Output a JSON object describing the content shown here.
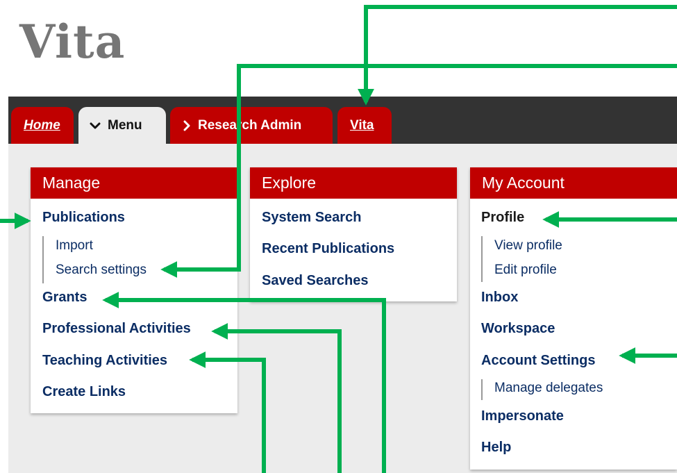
{
  "app": {
    "title": "Vita"
  },
  "nav": {
    "tabs": [
      {
        "label": "Home",
        "icon": ""
      },
      {
        "label": "Menu",
        "icon": "chevron-down-icon"
      },
      {
        "label": "Research Admin",
        "icon": "chevron-right-icon"
      },
      {
        "label": "Vita",
        "icon": ""
      }
    ]
  },
  "panels": {
    "manage": {
      "title": "Manage",
      "items": {
        "publications": "Publications",
        "import": "Import",
        "search_settings": "Search settings",
        "grants": "Grants",
        "professional_activities": "Professional Activities",
        "teaching_activities": "Teaching Activities",
        "create_links": "Create Links"
      }
    },
    "explore": {
      "title": "Explore",
      "items": {
        "system_search": "System Search",
        "recent_publications": "Recent Publications",
        "saved_searches": "Saved Searches"
      }
    },
    "account": {
      "title": "My Account",
      "items": {
        "profile": "Profile",
        "view_profile": "View profile",
        "edit_profile": "Edit profile",
        "inbox": "Inbox",
        "workspace": "Workspace",
        "account_settings": "Account Settings",
        "manage_delegates": "Manage delegates",
        "impersonate": "Impersonate",
        "help": "Help"
      }
    }
  },
  "colors": {
    "brand_red": "#c00000",
    "nav_dark": "#333333",
    "link_blue": "#0b2d64",
    "annotation_green": "#00b050"
  }
}
